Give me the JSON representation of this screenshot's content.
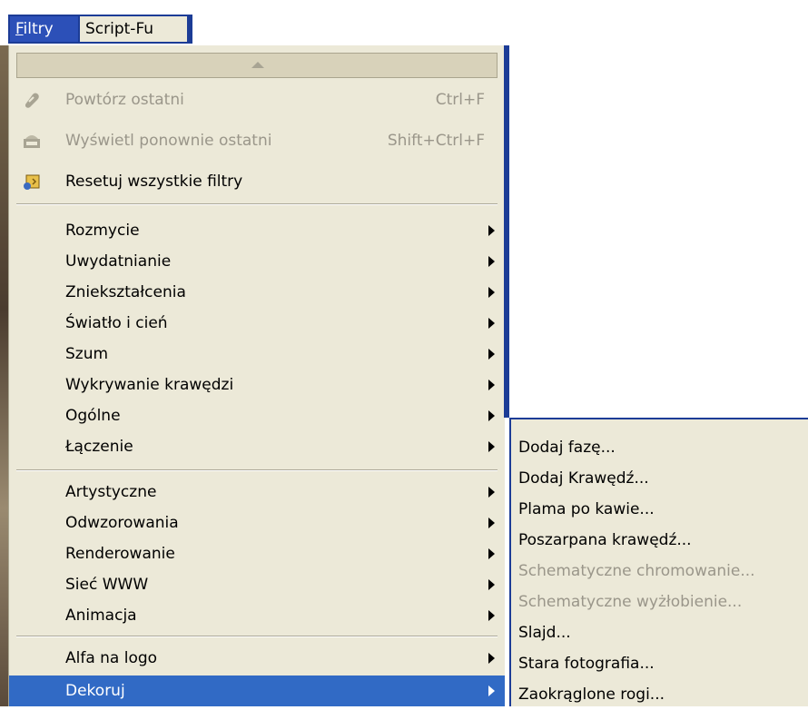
{
  "menubar": {
    "items": [
      {
        "label": "Filtry",
        "mnemonic_index": 0
      },
      {
        "label": "Script-Fu"
      }
    ]
  },
  "menu": {
    "top_items": [
      {
        "label": "Powtórz ostatni",
        "shortcut": "Ctrl+F",
        "icon": "repeat-icon",
        "enabled": false
      },
      {
        "label": "Wyświetl ponownie ostatni",
        "shortcut": "Shift+Ctrl+F",
        "icon": "reshow-icon",
        "enabled": false
      },
      {
        "label": "Resetuj wszystkie filtry",
        "icon": "reset-icon",
        "enabled": true
      }
    ],
    "group1": [
      "Rozmycie",
      "Uwydatnianie",
      "Zniekształcenia",
      "Światło i cień",
      "Szum",
      "Wykrywanie krawędzi",
      "Ogólne",
      "Łączenie"
    ],
    "group2": [
      "Artystyczne",
      "Odwzorowania",
      "Renderowanie",
      "Sieć WWW",
      "Animacja"
    ],
    "group3": [
      "Alfa na logo",
      "Dekoruj"
    ],
    "selected": "Dekoruj"
  },
  "submenu": {
    "items": [
      {
        "label": "Dodaj fazę...",
        "enabled": true
      },
      {
        "label": "Dodaj Krawędź...",
        "enabled": true
      },
      {
        "label": "Plama po kawie...",
        "enabled": true
      },
      {
        "label": "Poszarpana krawędź...",
        "enabled": true
      },
      {
        "label": "Schematyczne chromowanie...",
        "enabled": false
      },
      {
        "label": "Schematyczne wyżłobienie...",
        "enabled": false
      },
      {
        "label": "Slajd...",
        "enabled": true
      },
      {
        "label": "Stara fotografia...",
        "enabled": true
      },
      {
        "label": "Zaokrąglone rogi...",
        "enabled": true
      }
    ]
  },
  "colors": {
    "menu_bg": "#ece9d8",
    "selection": "#316ac5",
    "menubar_blue": "#1c3c96",
    "disabled_text": "#9a968a"
  }
}
